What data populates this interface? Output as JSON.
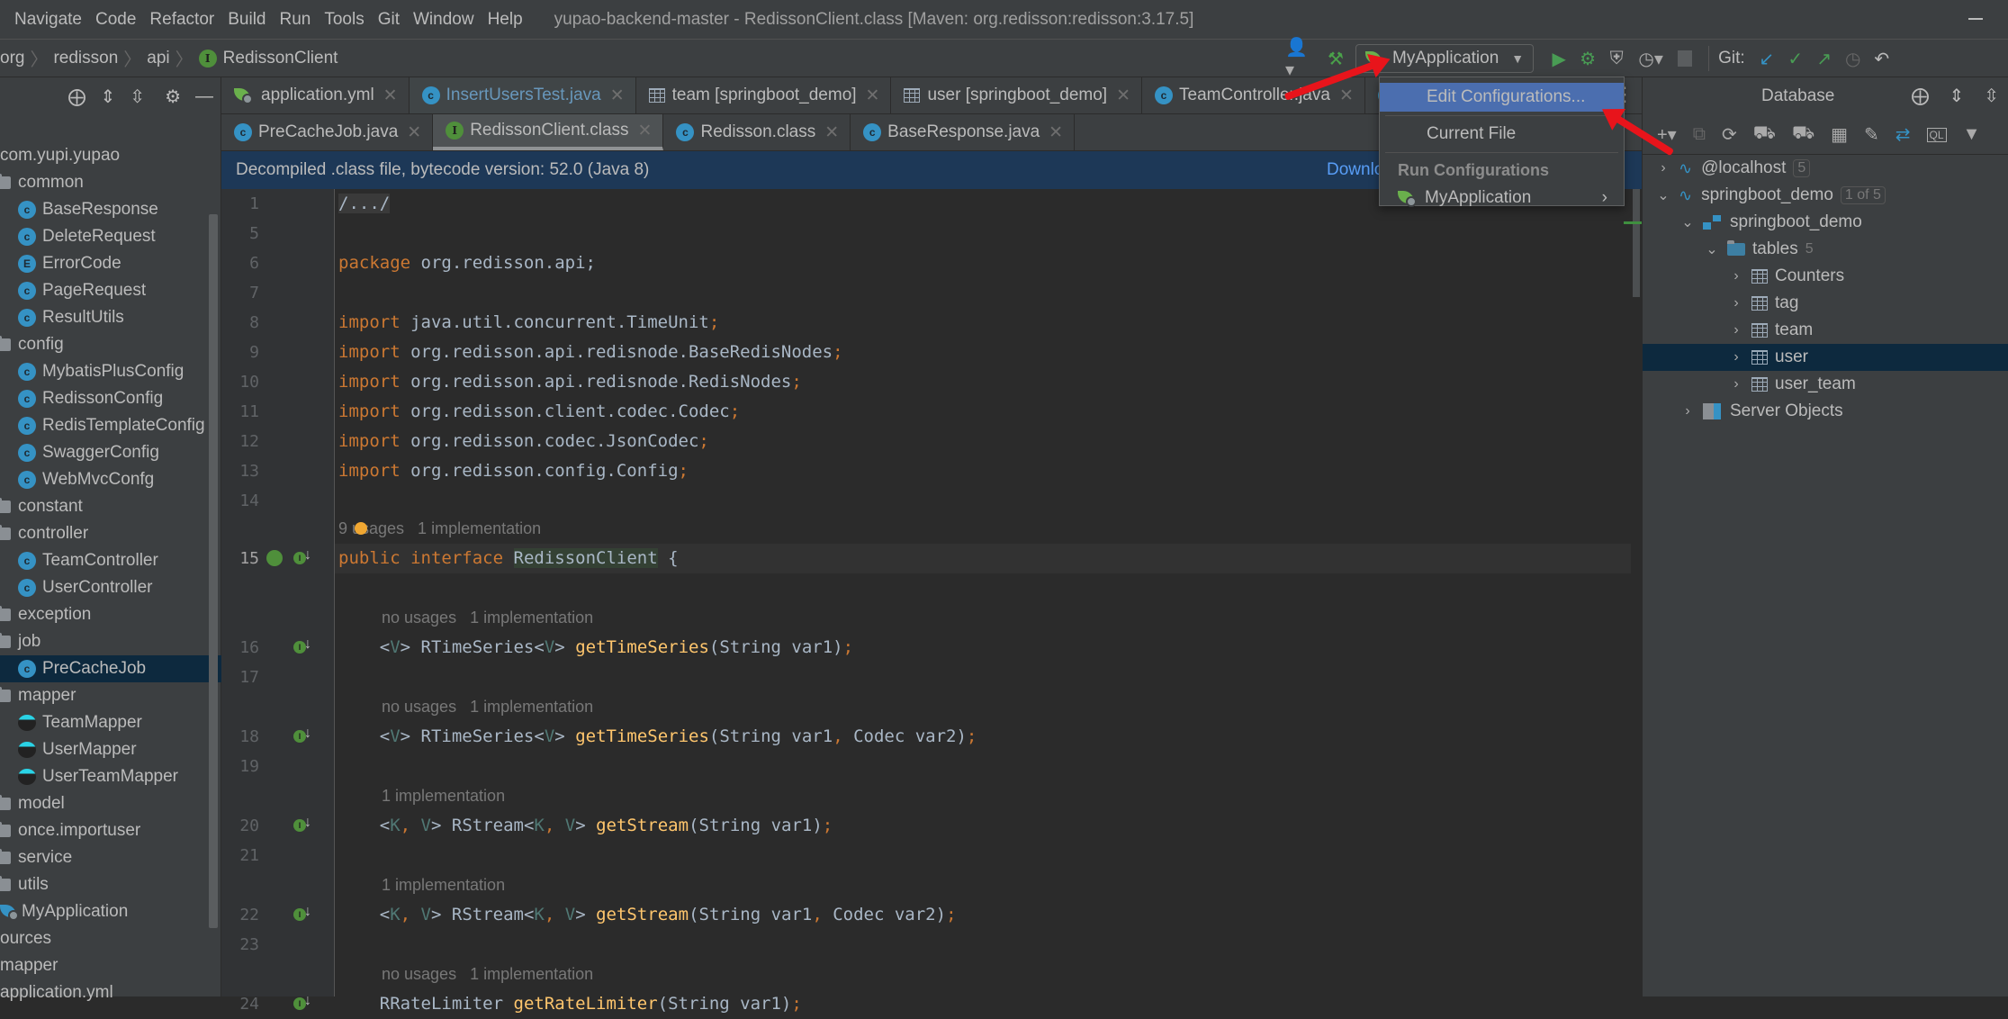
{
  "menubar": {
    "items": [
      "Navigate",
      "Code",
      "Refactor",
      "Build",
      "Run",
      "Tools",
      "Git",
      "Window",
      "Help"
    ],
    "window_title": "yupao-backend-master - RedissonClient.class [Maven: org.redisson:redisson:3.17.5]"
  },
  "breadcrumb": [
    "org",
    "redisson",
    "api",
    "RedissonClient"
  ],
  "toolbar": {
    "run_config": "MyApplication",
    "git_label": "Git:"
  },
  "run_popup": {
    "edit_configurations": "Edit Configurations...",
    "current_file": "Current File",
    "group_label": "Run Configurations",
    "app_item": "MyApplication"
  },
  "project_tree": [
    {
      "label": "com.yupi.yupao",
      "type": "package",
      "indent": 0
    },
    {
      "label": "common",
      "type": "folder",
      "indent": 0
    },
    {
      "label": "BaseResponse",
      "type": "class",
      "indent": 1
    },
    {
      "label": "DeleteRequest",
      "type": "class",
      "indent": 1
    },
    {
      "label": "ErrorCode",
      "type": "enum",
      "indent": 1
    },
    {
      "label": "PageRequest",
      "type": "class",
      "indent": 1
    },
    {
      "label": "ResultUtils",
      "type": "class",
      "indent": 1
    },
    {
      "label": "config",
      "type": "folder",
      "indent": 0
    },
    {
      "label": "MybatisPlusConfig",
      "type": "class",
      "indent": 1
    },
    {
      "label": "RedissonConfig",
      "type": "class",
      "indent": 1
    },
    {
      "label": "RedisTemplateConfig",
      "type": "class",
      "indent": 1
    },
    {
      "label": "SwaggerConfig",
      "type": "class",
      "indent": 1
    },
    {
      "label": "WebMvcConfg",
      "type": "class",
      "indent": 1
    },
    {
      "label": "constant",
      "type": "folder",
      "indent": 0
    },
    {
      "label": "controller",
      "type": "folder",
      "indent": 0
    },
    {
      "label": "TeamController",
      "type": "class",
      "indent": 1
    },
    {
      "label": "UserController",
      "type": "class",
      "indent": 1
    },
    {
      "label": "exception",
      "type": "folder",
      "indent": 0
    },
    {
      "label": "job",
      "type": "folder",
      "indent": 0
    },
    {
      "label": "PreCacheJob",
      "type": "class",
      "indent": 1,
      "selected": true
    },
    {
      "label": "mapper",
      "type": "folder",
      "indent": 0
    },
    {
      "label": "TeamMapper",
      "type": "mapper",
      "indent": 1
    },
    {
      "label": "UserMapper",
      "type": "mapper",
      "indent": 1
    },
    {
      "label": "UserTeamMapper",
      "type": "mapper",
      "indent": 1
    },
    {
      "label": "model",
      "type": "folder",
      "indent": 0
    },
    {
      "label": "once.importuser",
      "type": "folder",
      "indent": 0
    },
    {
      "label": "service",
      "type": "folder",
      "indent": 0
    },
    {
      "label": "utils",
      "type": "folder",
      "indent": 0
    },
    {
      "label": "MyApplication",
      "type": "spring",
      "indent": 0
    },
    {
      "label": "ources",
      "type": "plain",
      "indent": 0
    },
    {
      "label": "mapper",
      "type": "plain",
      "indent": 0
    },
    {
      "label": "application.yml",
      "type": "plain",
      "indent": 0
    }
  ],
  "tabs_row1": [
    {
      "label": "application.yml",
      "icon": "spring"
    },
    {
      "label": "InsertUsersTest.java",
      "icon": "class",
      "highlight": true
    },
    {
      "label": "team [springboot_demo]",
      "icon": "table"
    },
    {
      "label": "user [springboot_demo]",
      "icon": "table"
    },
    {
      "label": "TeamController.java",
      "icon": "class"
    }
  ],
  "tabs_row2": [
    {
      "label": "PreCacheJob.java",
      "icon": "class"
    },
    {
      "label": "RedissonClient.class",
      "icon": "interface",
      "active": true
    },
    {
      "label": "Redisson.class",
      "icon": "class"
    },
    {
      "label": "BaseResponse.java",
      "icon": "class"
    }
  ],
  "banner": {
    "text": "Decompiled .class file, bytecode version: 52.0 (Java 8)",
    "download_link": "Downlo"
  },
  "code": {
    "line_numbers": [
      "1",
      "5",
      "6",
      "7",
      "8",
      "9",
      "10",
      "11",
      "12",
      "13",
      "14",
      "15",
      "16",
      "17",
      "18",
      "19",
      "20",
      "21",
      "22",
      "23",
      "24"
    ],
    "folded": "/.../",
    "package_kw": "package",
    "package_name": " org.redisson.api;",
    "imports": [
      "java.util.concurrent.TimeUnit",
      "org.redisson.api.redisnode.BaseRedisNodes",
      "org.redisson.api.redisnode.RedisNodes",
      "org.redisson.client.codec.Codec",
      "org.redisson.codec.JsonCodec",
      "org.redisson.config.Config"
    ],
    "import_kw": "import",
    "interface_hint": "9 usages   1 implementation",
    "interface_decl": {
      "kw1": "public",
      "kw2": "interface",
      "name": "RedissonClient",
      "brace": " {"
    },
    "methods": [
      {
        "hint": "no usages   1 implementation",
        "generics": "V",
        "ret": "RTimeSeries",
        "fn": "getTimeSeries",
        "params": "String var1"
      },
      {
        "hint": "no usages   1 implementation",
        "generics": "V",
        "ret": "RTimeSeries",
        "fn": "getTimeSeries",
        "params": "String var1, Codec var2"
      },
      {
        "hint": "1 implementation",
        "generics": "K, V",
        "ret": "RStream",
        "fn": "getStream",
        "params": "String var1"
      },
      {
        "hint": "1 implementation",
        "generics": "K, V",
        "ret": "RStream",
        "fn": "getStream",
        "params": "String var1, Codec var2"
      },
      {
        "hint": "no usages   1 implementation",
        "generics": "",
        "ret": "RRateLimiter",
        "fn": "getRateLimiter",
        "params": "String var1"
      }
    ]
  },
  "database": {
    "title": "Database",
    "nodes": [
      {
        "label": "@localhost",
        "badge": "5",
        "level": 0,
        "expanded": false,
        "icon": "mysql"
      },
      {
        "label": "springboot_demo",
        "badge": "1 of 5",
        "level": 0,
        "expanded": true,
        "icon": "mysql"
      },
      {
        "label": "springboot_demo",
        "level": 1,
        "expanded": true,
        "icon": "schema"
      },
      {
        "label": "tables",
        "count": "5",
        "level": 2,
        "expanded": true,
        "icon": "folder"
      },
      {
        "label": "Counters",
        "level": 3,
        "icon": "table"
      },
      {
        "label": "tag",
        "level": 3,
        "icon": "table"
      },
      {
        "label": "team",
        "level": 3,
        "icon": "table"
      },
      {
        "label": "user",
        "level": 3,
        "icon": "table",
        "selected": true
      },
      {
        "label": "user_team",
        "level": 3,
        "icon": "table"
      },
      {
        "label": "Server Objects",
        "level": 1,
        "icon": "server"
      }
    ]
  },
  "colors": {
    "accent": "#4b6eaf",
    "selection": "#0d293e",
    "banner": "#1d3857",
    "annotation_arrow": "#e8141b"
  }
}
